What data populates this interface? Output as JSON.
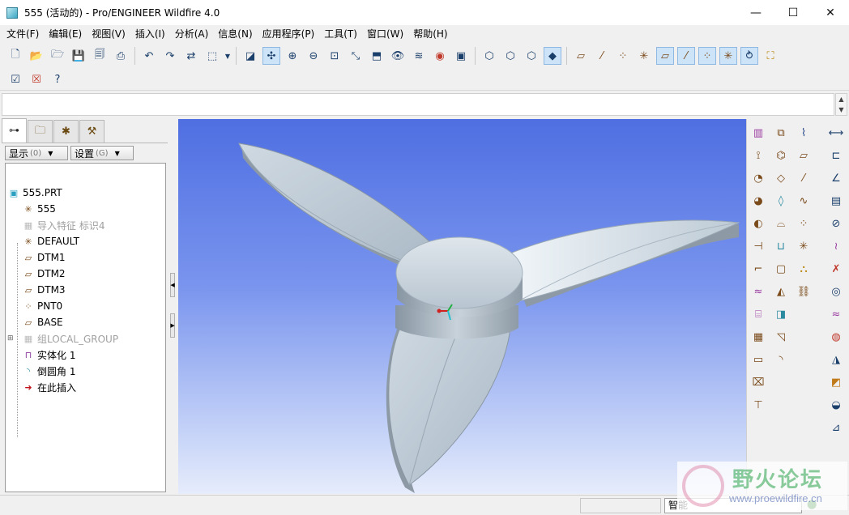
{
  "window": {
    "title": "555 (活动的) - Pro/ENGINEER Wildfire 4.0",
    "controls": [
      "—",
      "☐",
      "✕"
    ]
  },
  "menu": [
    "文件(F)",
    "编辑(E)",
    "视图(V)",
    "插入(I)",
    "分析(A)",
    "信息(N)",
    "应用程序(P)",
    "工具(T)",
    "窗口(W)",
    "帮助(H)"
  ],
  "toolbar": {
    "row1_icons": [
      "new-icon",
      "open-icon",
      "open-folder-icon",
      "save-icon",
      "save-copy-icon",
      "print-icon",
      "undo-icon",
      "redo-icon",
      "regenerate-icon",
      "select-box-icon",
      "repaint-icon",
      "spin-center-icon",
      "zoom-in-icon",
      "zoom-out-icon",
      "refit-icon",
      "orient-icon",
      "saved-views-icon",
      "layers-icon",
      "view-manager-icon",
      "appearance-icon",
      "model-tree-icon",
      "wireframe-icon",
      "hidden-line-icon",
      "no-hidden-icon",
      "shading-icon",
      "datum-plane-display-icon",
      "datum-axis-display-icon",
      "point-display-icon",
      "csys-display-icon",
      "datum-plane-tag-icon",
      "datum-axis-tag-icon",
      "point-tag-icon",
      "csys-tag-icon",
      "spin-icon",
      "annotation-icon"
    ],
    "row2_icons": [
      "window-activate-icon",
      "close-window-icon",
      "whats-this-icon"
    ]
  },
  "left_panel": {
    "tabs": [
      "model-tree-tab",
      "folder-browser-tab",
      "favorites-tab",
      "connections-tab"
    ],
    "show_button": {
      "label": "显示",
      "hint": "(0)"
    },
    "settings_button": {
      "label": "设置",
      "hint": "(G)"
    },
    "tree": [
      {
        "label": "555.PRT",
        "icon": "part-icon",
        "level": 0,
        "gray": false
      },
      {
        "label": "555",
        "icon": "csys-icon",
        "level": 1,
        "gray": false
      },
      {
        "label": "导入特征 标识4",
        "icon": "import-feature-icon",
        "level": 1,
        "gray": true
      },
      {
        "label": "DEFAULT",
        "icon": "csys-icon",
        "level": 1,
        "gray": false
      },
      {
        "label": "DTM1",
        "icon": "datum-plane-icon",
        "level": 1,
        "gray": false
      },
      {
        "label": "DTM2",
        "icon": "datum-plane-icon",
        "level": 1,
        "gray": false
      },
      {
        "label": "DTM3",
        "icon": "datum-plane-icon",
        "level": 1,
        "gray": false
      },
      {
        "label": "PNT0",
        "icon": "datum-point-icon",
        "level": 1,
        "gray": false
      },
      {
        "label": "BASE",
        "icon": "datum-plane-icon",
        "level": 1,
        "gray": false
      },
      {
        "label": "组LOCAL_GROUP",
        "icon": "group-icon",
        "level": 1,
        "gray": true
      },
      {
        "label": "实体化 1",
        "icon": "solidify-icon",
        "level": 1,
        "gray": false
      },
      {
        "label": "倒圆角 1",
        "icon": "round-icon",
        "level": 1,
        "gray": false
      },
      {
        "label": "在此插入",
        "icon": "insert-here-icon",
        "level": 1,
        "gray": false
      }
    ]
  },
  "status": {
    "filter": "智能"
  },
  "watermark": {
    "title": "野火论坛",
    "url": "www.proewildfire.cn"
  }
}
